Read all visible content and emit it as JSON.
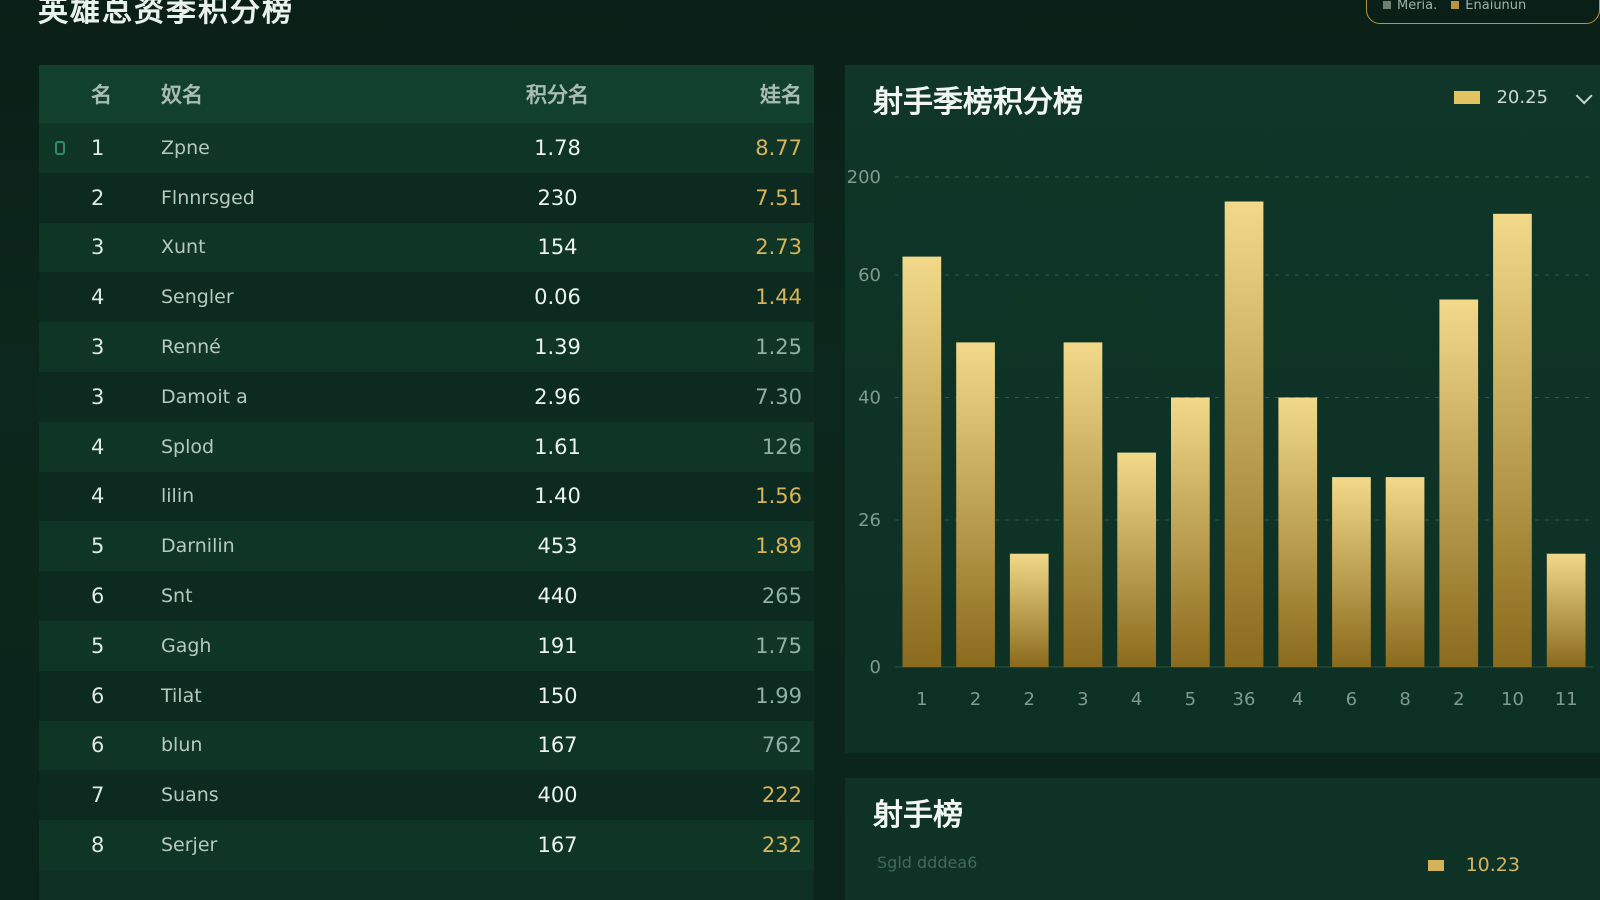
{
  "header": {
    "title": "英雄总资季积分榜",
    "filter_a": "Meria.",
    "filter_b": "Enaiunun"
  },
  "table": {
    "headers": [
      "名",
      "奴名",
      "积分名",
      "娃名"
    ],
    "rows": [
      {
        "rank": "1",
        "name": "Zpne",
        "score": "1.78",
        "last": "8.77",
        "marker": true
      },
      {
        "rank": "2",
        "name": "Flnnrsged",
        "score": "230",
        "last": "7.51"
      },
      {
        "rank": "3",
        "name": "Xunt",
        "score": "154",
        "last": "2.73"
      },
      {
        "rank": "4",
        "name": "Sengler",
        "score": "0.06",
        "last": "1.44"
      },
      {
        "rank": "3",
        "name": "Renné",
        "score": "1.39",
        "last": "1.25",
        "dim": true
      },
      {
        "rank": "3",
        "name": "Damoit a",
        "score": "2.96",
        "last": "7.30",
        "dim": true
      },
      {
        "rank": "4",
        "name": "Splod",
        "score": "1.61",
        "last": "126",
        "dim": true
      },
      {
        "rank": "4",
        "name": "lilin",
        "score": "1.40",
        "last": "1.56"
      },
      {
        "rank": "5",
        "name": "Darnilin",
        "score": "453",
        "last": "1.89"
      },
      {
        "rank": "6",
        "name": "Snt",
        "score": "440",
        "last": "265",
        "dim": true
      },
      {
        "rank": "5",
        "name": "Gagh",
        "score": "191",
        "last": "1.75",
        "dim": true
      },
      {
        "rank": "6",
        "name": "Tilat",
        "score": "150",
        "last": "1.99",
        "dim": true
      },
      {
        "rank": "6",
        "name": "blun",
        "score": "167",
        "last": "762",
        "dim": true
      },
      {
        "rank": "7",
        "name": "Suans",
        "score": "400",
        "last": "222"
      },
      {
        "rank": "8",
        "name": "Serjer",
        "score": "167",
        "last": "232"
      }
    ]
  },
  "chart_panel": {
    "title": "射手季榜积分榜",
    "legend_value": "20.25"
  },
  "chart_data": {
    "type": "bar",
    "title": "射手季榜积分榜",
    "categories": [
      "1",
      "2",
      "2",
      "3",
      "4",
      "5",
      "36",
      "4",
      "6",
      "8",
      "2",
      "10",
      "11"
    ],
    "values": [
      67,
      53,
      18.5,
      53,
      35,
      44,
      76,
      44,
      31,
      31,
      60,
      74,
      18.5
    ],
    "ytick_labels": [
      "200",
      "60",
      "40",
      "26",
      "0"
    ],
    "ytick_values": [
      80,
      64,
      44,
      24,
      0
    ],
    "ylim": [
      0,
      80
    ],
    "grid": true,
    "legend": {
      "label": "20.25",
      "position": "top-right"
    },
    "xlabel": "",
    "ylabel": ""
  },
  "bottom_panel": {
    "title": "射手榜",
    "subtitle": "Sgld dddea6",
    "legend_value": "10.23"
  },
  "colors": {
    "bar_top": "#f2d98a",
    "bar_bottom": "#8a6a1c",
    "accent_gold": "#d7b45a",
    "background": "#0b2219"
  }
}
